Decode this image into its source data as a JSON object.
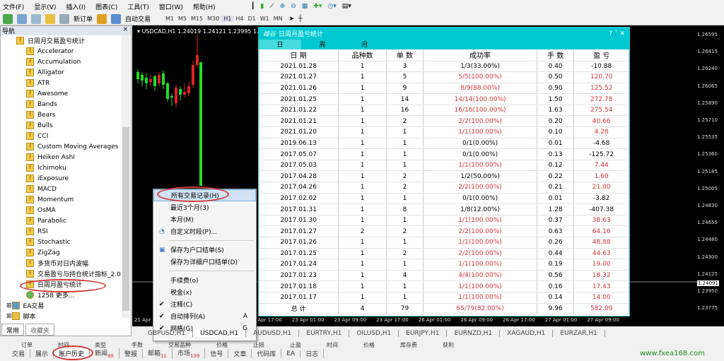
{
  "menubar": [
    "文件(F)",
    "显示(V)",
    "插入(I)",
    "图表(C)",
    "工具(T)",
    "窗口(W)",
    "帮助(H)"
  ],
  "toolbar": {
    "new_order": "新订单",
    "auto_trade": "自动交易",
    "timeframes": [
      "M1",
      "M5",
      "M15",
      "M30",
      "H1",
      "H4",
      "D1",
      "W1",
      "MN"
    ],
    "active_timeframe": "H1"
  },
  "navigator": {
    "title": "导航",
    "close": "×",
    "items": [
      "日周月交易盈亏统计",
      "Accelerator",
      "Accumulation",
      "Alligator",
      "ATR",
      "Awesome",
      "Bands",
      "Bears",
      "Bulls",
      "CCI",
      "Custom Moving Averages",
      "Heiken Ashi",
      "Ichimoku",
      "iExposure",
      "MACD",
      "Momentum",
      "OsMA",
      "Parabolic",
      "RSI",
      "Stochastic",
      "ZigZag",
      "多货币对日内波幅",
      "交易盈亏与持仓统计指标_2.0",
      "日周月盈亏统计",
      "1258 更多..."
    ],
    "groups": [
      "EA交易",
      "脚本"
    ],
    "tabs": [
      "常用",
      "收藏夹"
    ]
  },
  "chart": {
    "title": "USDCAD,H1  1.24019 1.24121 1.23995 1.24091",
    "prices": [
      "1.26595",
      "1.26415",
      "1.26240",
      "1.26065",
      "1.25890",
      "1.25710",
      "1.25535",
      "1.25360",
      "1.25185",
      "1.25005",
      "1.24830",
      "1.24655",
      "1.24480",
      "1.24300",
      "1.24125",
      "1.23950",
      "1.23775"
    ],
    "current_price": "1.24091",
    "times": [
      "21 Apr 2",
      "22 Apr 01:00",
      "22 Apr 09:00",
      "22 Apr 17:00",
      "23 Apr 01:00",
      "23 Apr 09:00",
      "23 Apr 17:00",
      "26 Apr 01:00",
      "26 Apr 09:00",
      "26 Apr 17:00",
      "27 Apr 01:00",
      "27 Apr 09:00"
    ],
    "bull_color": "#22dd22",
    "bear_color": "#dd2222"
  },
  "stats": {
    "logo": "峰谷",
    "title": "日周月盈亏统计",
    "tabs": [
      "日",
      "周",
      "月"
    ],
    "active_tab": "日",
    "headers": [
      "日 期",
      "品种数",
      "单 数",
      "成功率",
      "手 数",
      "盈 亏"
    ],
    "rows": [
      [
        "2021.01.28",
        "1",
        "3",
        "1/3(33.00%)",
        "0.40",
        "-10.88"
      ],
      [
        "2021.01.27",
        "1",
        "5",
        "5/5(100.00%)",
        "0.50",
        "120.70"
      ],
      [
        "2021.01.26",
        "1",
        "9",
        "8/9(88.00%)",
        "0.90",
        "125.52"
      ],
      [
        "2021.01.25",
        "1",
        "14",
        "14/14(100.00%)",
        "1.50",
        "272.78"
      ],
      [
        "2021.01.22",
        "1",
        "16",
        "16/16(100.00%)",
        "1.63",
        "275.54"
      ],
      [
        "2021.01.21",
        "1",
        "2",
        "2/2(100.00%)",
        "0.20",
        "40.66"
      ],
      [
        "2021.01.20",
        "1",
        "1",
        "1/1(100.00%)",
        "0.10",
        "4.28"
      ],
      [
        "2019.06.13",
        "1",
        "1",
        "0/1(0.00%)",
        "0.01",
        "-4.68"
      ],
      [
        "2017.05.07",
        "1",
        "1",
        "0/1(0.00%)",
        "0.13",
        "-125.72"
      ],
      [
        "2017.05.03",
        "1",
        "1",
        "1/1(100.00%)",
        "0.12",
        "7.44"
      ],
      [
        "2017.04.28",
        "1",
        "2",
        "1/2(50.00%)",
        "0.22",
        "1.60"
      ],
      [
        "2017.04.26",
        "1",
        "2",
        "2/2(100.00%)",
        "0.21",
        "21.00"
      ],
      [
        "2017.02.02",
        "1",
        "1",
        "0/1(0.00%)",
        "0.01",
        "-3.82"
      ],
      [
        "2017.01.31",
        "1",
        "8",
        "1/8(12.00%)",
        "1.28",
        "-407.38"
      ],
      [
        "2017.01.30",
        "1",
        "1",
        "1/1(100.00%)",
        "0.37",
        "38.63"
      ],
      [
        "2017.01.27",
        "2",
        "2",
        "2/2(100.00%)",
        "0.63",
        "64.16"
      ],
      [
        "2017.01.26",
        "1",
        "1",
        "1/1(100.00%)",
        "0.26",
        "48.88"
      ],
      [
        "2017.01.25",
        "1",
        "2",
        "2/2(100.00%)",
        "0.44",
        "44.63"
      ],
      [
        "2017.01.24",
        "1",
        "1",
        "1/1(100.00%)",
        "0.19",
        "19.00"
      ],
      [
        "2017.01.23",
        "1",
        "4",
        "4/4(100.00%)",
        "0.56",
        "18.32"
      ],
      [
        "2017.01.18",
        "1",
        "1",
        "1/1(100.00%)",
        "0.16",
        "17.43"
      ],
      [
        "2017.01.17",
        "1",
        "1",
        "1/1(100.00%)",
        "0.14",
        "14.00"
      ]
    ],
    "total": [
      "总 计",
      "4",
      "79",
      "65/79(82.00%)",
      "9.96",
      "582.09"
    ],
    "profit_color": "#d6333b"
  },
  "context_menu": [
    {
      "label": "所有交易记录(H)",
      "selected": true
    },
    {
      "label": "最近3个月(3)"
    },
    {
      "label": "本月(M)"
    },
    {
      "label": "自定义时段(P)..."
    },
    {
      "sep": true
    },
    {
      "label": "保存为户口结单(S)"
    },
    {
      "label": "保存为详细户口结单(D)"
    },
    {
      "sep": true
    },
    {
      "label": "手续费(o)"
    },
    {
      "label": "税金(x)"
    },
    {
      "label": "注释(C)",
      "checked": true
    },
    {
      "label": "自动排列(A)",
      "checked": true,
      "shortcut": "A"
    },
    {
      "label": "网格(G)",
      "checked": true,
      "shortcut": "G"
    }
  ],
  "symbol_tabs": [
    "GBPUSD,H1",
    "USDCAD,H1",
    "AUDUSD,H1",
    "EURTRY,H1",
    "OILUSD,H1",
    "EURJPY,H1",
    "EURNZD,H1",
    "XAGAUD,H1",
    "EURZAR,H1"
  ],
  "terminal": {
    "columns": [
      "订单",
      "时间",
      "类型",
      "手数",
      "交易品种",
      "价格",
      "止损",
      "止盈",
      "时间",
      "价格",
      "库存费",
      "获利"
    ],
    "tabs": [
      {
        "label": "交易"
      },
      {
        "label": "展示"
      },
      {
        "label": "账户历史"
      },
      {
        "label": "新闻",
        "badge": "88"
      },
      {
        "label": "警报"
      },
      {
        "label": "邮箱",
        "badge": "11"
      },
      {
        "label": "市场",
        "badge": "139"
      },
      {
        "label": "信号"
      },
      {
        "label": "文章"
      },
      {
        "label": "代码库"
      },
      {
        "label": "EA"
      },
      {
        "label": "日志"
      }
    ],
    "active_tab": "账户历史"
  },
  "watermark": "www.fxea168.com"
}
